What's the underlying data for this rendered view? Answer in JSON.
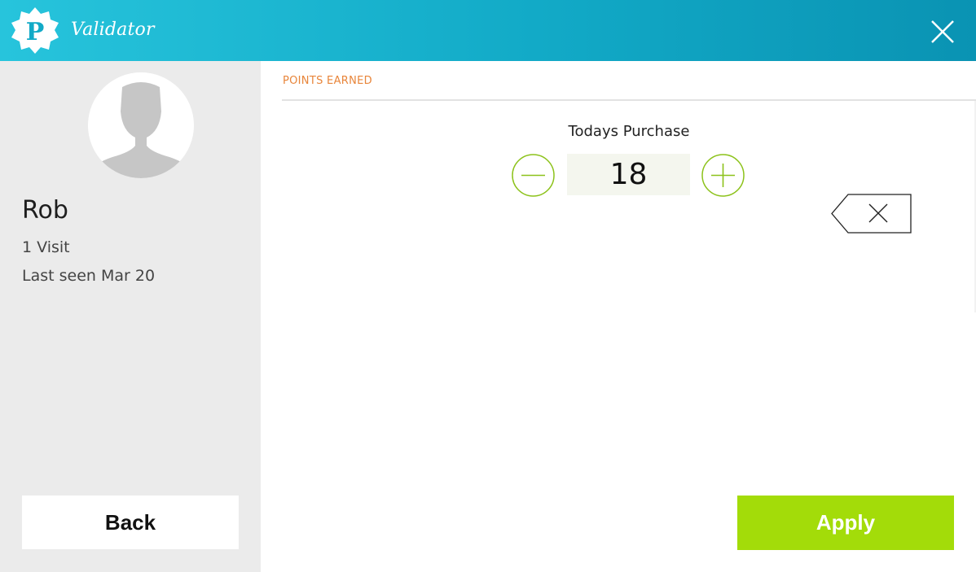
{
  "header": {
    "app_title": "Validator",
    "logo_letter": "P",
    "close_icon": "close-icon"
  },
  "customer": {
    "name": "Rob",
    "visits": "1 Visit",
    "last_seen": "Last seen Mar 20",
    "back_label": "Back"
  },
  "points": {
    "section_title": "POINTS EARNED",
    "purchase_label": "Todays Purchase",
    "quantity": "18",
    "minus_icon": "minus-icon",
    "plus_icon": "plus-icon",
    "backspace_icon": "backspace-icon",
    "apply_label": "Apply"
  },
  "colors": {
    "header_gradient_start": "#27c4dc",
    "header_gradient_end": "#0a93b3",
    "accent_orange": "#e8853a",
    "accent_green": "#8cc21a",
    "apply_green": "#a3dc09",
    "sidebar_bg": "#ebebeb"
  }
}
